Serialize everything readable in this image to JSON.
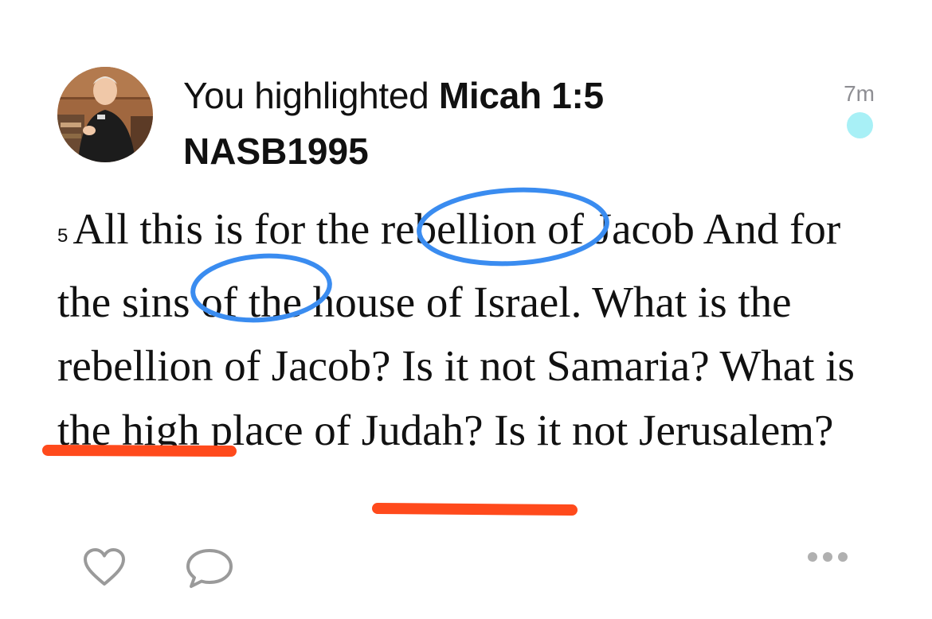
{
  "activity": {
    "prefix": "You highlighted ",
    "reference": "Micah 1:5",
    "version": "NASB1995",
    "time_ago": "7m",
    "unread_dot_color": "#a8f0f6"
  },
  "verse": {
    "number": "5",
    "text_part1": "All this is for the ",
    "word_rebellion": "rebellion",
    "text_part2": " of Jacob And for the ",
    "word_sins_of": "sins of",
    "text_part3": " the house of Israel. What is the rebellion of Jacob? Is it not ",
    "word_samaria": "Samaria",
    "text_part4": "? What is the high place of Judah? Is it not ",
    "word_jerusalem": "Jerusalem",
    "text_part5": "?"
  },
  "annotations": {
    "circle_color": "#3a8cf0",
    "underline_color": "#ff4a1c"
  },
  "footer": {
    "like_icon": "heart-icon",
    "comment_icon": "comment-icon",
    "more_icon": "ellipsis-icon"
  }
}
